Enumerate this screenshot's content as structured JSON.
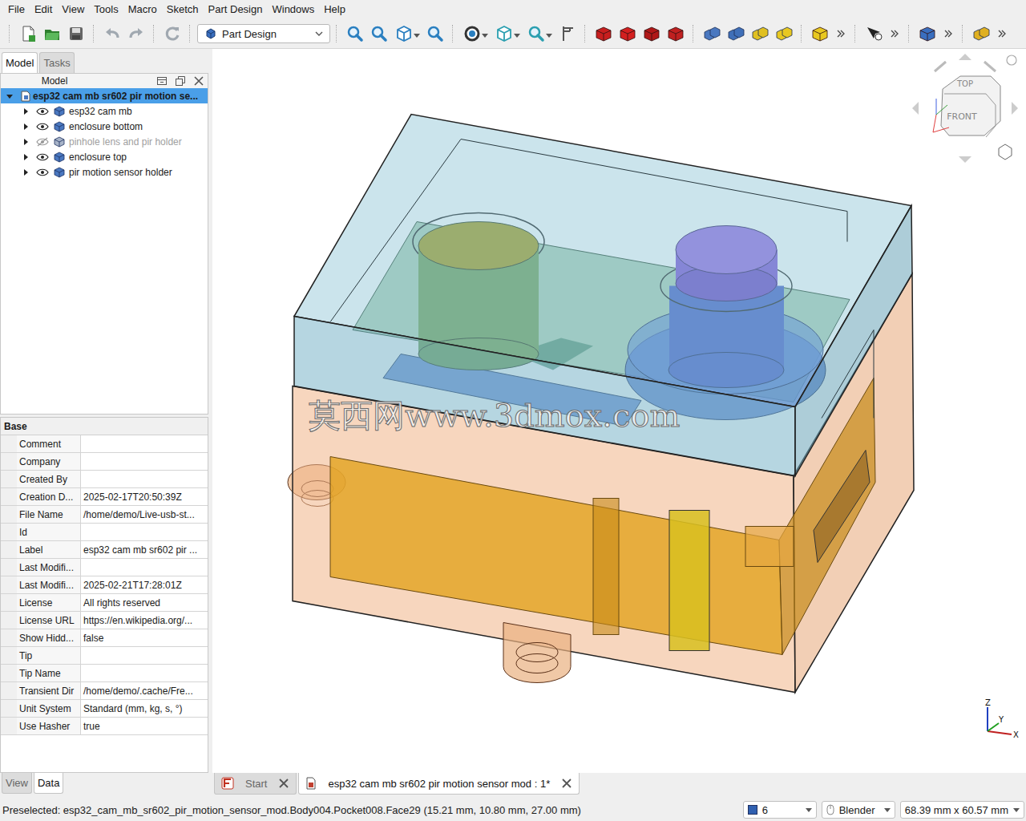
{
  "menu": [
    "File",
    "Edit",
    "View",
    "Tools",
    "Macro",
    "Sketch",
    "Part Design",
    "Windows",
    "Help"
  ],
  "toolbar": {
    "workbench": "Part Design"
  },
  "left_panel": {
    "tabs": [
      {
        "label": "Model",
        "selected": true
      },
      {
        "label": "Tasks",
        "selected": false
      }
    ],
    "tree": {
      "title": "Model",
      "items": [
        {
          "label": "esp32 cam mb sr602 pir motion se...",
          "kind": "document",
          "level": 0,
          "expanded": true,
          "visible": true,
          "selected": true
        },
        {
          "label": "esp32 cam mb",
          "kind": "body",
          "level": 1,
          "expanded": false,
          "visible": true,
          "selected": false
        },
        {
          "label": "enclosure bottom",
          "kind": "body",
          "level": 1,
          "expanded": false,
          "visible": true,
          "selected": false
        },
        {
          "label": "pinhole lens and pir holder",
          "kind": "body",
          "level": 1,
          "expanded": false,
          "visible": false,
          "selected": false
        },
        {
          "label": "enclosure top",
          "kind": "body",
          "level": 1,
          "expanded": false,
          "visible": true,
          "selected": false
        },
        {
          "label": "pir motion sensor holder",
          "kind": "body",
          "level": 1,
          "expanded": false,
          "visible": true,
          "selected": false
        }
      ]
    },
    "properties": {
      "group": "Base",
      "rows": [
        {
          "name": "Comment",
          "value": ""
        },
        {
          "name": "Company",
          "value": ""
        },
        {
          "name": "Created By",
          "value": ""
        },
        {
          "name": "Creation D...",
          "value": "2025-02-17T20:50:39Z"
        },
        {
          "name": "File Name",
          "value": "/home/demo/Live-usb-st..."
        },
        {
          "name": "Id",
          "value": ""
        },
        {
          "name": "Label",
          "value": "esp32 cam mb sr602 pir ..."
        },
        {
          "name": "Last Modifi...",
          "value": ""
        },
        {
          "name": "Last Modifi...",
          "value": "2025-02-21T17:28:01Z"
        },
        {
          "name": "License",
          "value": "All rights reserved"
        },
        {
          "name": "License URL",
          "value": "https://en.wikipedia.org/..."
        },
        {
          "name": "Show Hidd...",
          "value": "false"
        },
        {
          "name": "Tip",
          "value": ""
        },
        {
          "name": "Tip Name",
          "value": ""
        },
        {
          "name": "Transient Dir",
          "value": "/home/demo/.cache/Fre..."
        },
        {
          "name": "Unit System",
          "value": "Standard (mm, kg, s, °)"
        },
        {
          "name": "Use Hasher",
          "value": "true"
        }
      ]
    },
    "bottom_tabs": [
      {
        "label": "View",
        "selected": false
      },
      {
        "label": "Data",
        "selected": true
      }
    ]
  },
  "viewport": {
    "watermark": "莫西网www.3dmox.com",
    "nav_cube": {
      "top": "TOP",
      "front": "FRONT"
    },
    "axes": {
      "z": "Z",
      "y": "Y",
      "x": "X"
    }
  },
  "doc_tabs": [
    {
      "label": "Start",
      "selected": false
    },
    {
      "label": "esp32 cam mb sr602 pir motion sensor mod : 1*",
      "selected": true
    }
  ],
  "status_bar": {
    "message": "Preselected: esp32_cam_mb_sr602_pir_motion_sensor_mod.Body004.Pocket008.Face29 (15.21 mm, 10.80 mm, 27.00 mm)",
    "draw_style": "6",
    "navigation": "Blender",
    "dimensions": "68.39 mm x 60.57 mm"
  }
}
